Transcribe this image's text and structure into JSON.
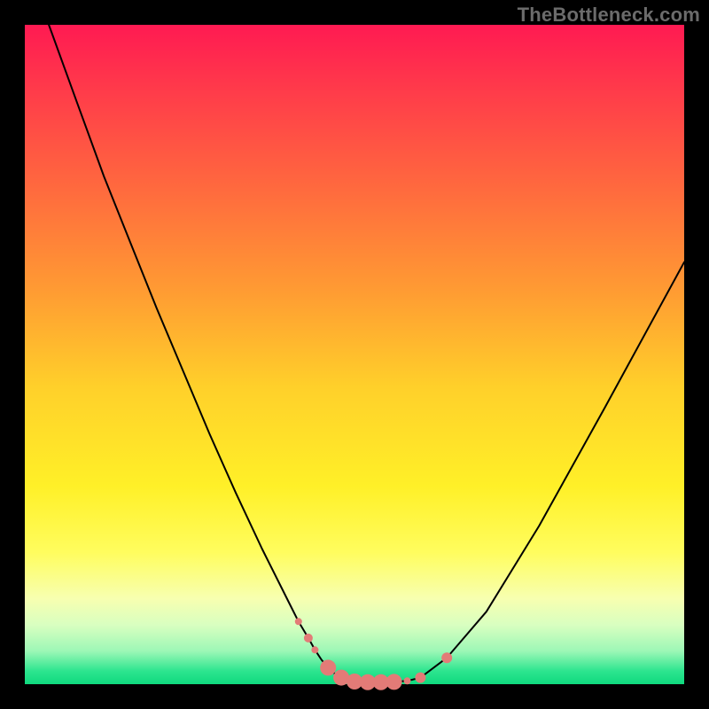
{
  "watermark": "TheBottleneck.com",
  "chart_data": {
    "type": "line",
    "title": "",
    "xlabel": "",
    "ylabel": "",
    "xlim": [
      0,
      100
    ],
    "ylim": [
      0,
      100
    ],
    "curve": {
      "name": "bottleneck-curve",
      "x": [
        0,
        4,
        8,
        12,
        16,
        20,
        24,
        28,
        32,
        36,
        40,
        41.5,
        43,
        44,
        45,
        46,
        47,
        48,
        49,
        50,
        52,
        54,
        56,
        58,
        60,
        64,
        70,
        78,
        88,
        100
      ],
      "y": [
        110,
        99,
        88,
        77,
        67,
        57,
        47.5,
        38,
        29,
        20.5,
        12.5,
        9.5,
        7,
        5.2,
        3.7,
        2.5,
        1.6,
        1,
        0.6,
        0.4,
        0.3,
        0.3,
        0.35,
        0.5,
        1,
        4,
        11,
        24,
        42,
        64
      ]
    },
    "points": {
      "name": "sample-points",
      "x": [
        41.5,
        43,
        44,
        46,
        48,
        50,
        52,
        54,
        56,
        58,
        60,
        64
      ],
      "y": [
        9.5,
        7,
        5.2,
        2.5,
        1,
        0.4,
        0.3,
        0.3,
        0.35,
        0.5,
        1,
        4
      ],
      "r": [
        4,
        5,
        4,
        9,
        9,
        9,
        9,
        9,
        9,
        4,
        6,
        6
      ]
    },
    "background_gradient": {
      "top_color": "#ff1a52",
      "mid_color": "#fff028",
      "bottom_color": "#0fd97e"
    }
  }
}
